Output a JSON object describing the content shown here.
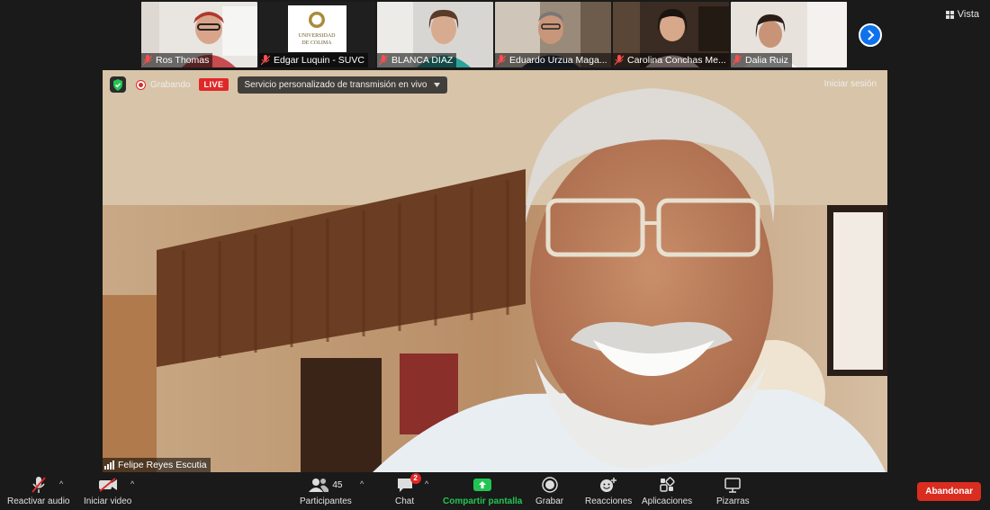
{
  "view_button": "Vista",
  "participants_strip": [
    {
      "name": "Ros Thomas"
    },
    {
      "name": "Edgar Luquin - SUVC",
      "logo_line1": "UNIVERSIDAD",
      "logo_line2": "DE COLIMA"
    },
    {
      "name": "BLANCA DIAZ"
    },
    {
      "name": "Eduardo Urzua Maga..."
    },
    {
      "name": "Carolina Conchas Me..."
    },
    {
      "name": "Dalia Ruiz"
    }
  ],
  "meeting_bar": {
    "recording_label": "Grabando",
    "live_label": "LIVE",
    "stream_service": "Servicio personalizado de transmisión en vivo",
    "signin_label": "Iniciar sesión"
  },
  "active_speaker": {
    "name": "Felipe Reyes Escutia"
  },
  "toolbar": {
    "unmute_label": "Reactivar audio",
    "start_video_label": "Iniciar video",
    "participants_label": "Participantes",
    "participants_count": "45",
    "chat_label": "Chat",
    "chat_badge": "2",
    "share_screen_label": "Compartir pantalla",
    "record_label": "Grabar",
    "reactions_label": "Reacciones",
    "apps_label": "Aplicaciones",
    "whiteboards_label": "Pizarras",
    "leave_label": "Abandonar"
  },
  "colors": {
    "accent_blue": "#0e72ed",
    "live_red": "#e02828",
    "share_green": "#23c552",
    "leave_red": "#d92d20"
  }
}
